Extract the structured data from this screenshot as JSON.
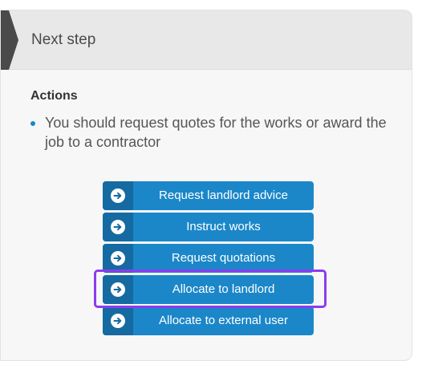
{
  "panel": {
    "title": "Next step"
  },
  "actions": {
    "heading": "Actions",
    "bullets": [
      "You should request quotes for the works or award the job to a contractor"
    ],
    "buttons": [
      {
        "label": "Request landlord advice",
        "icon": "arrow-right-circle-icon"
      },
      {
        "label": "Instruct works",
        "icon": "arrow-right-circle-icon"
      },
      {
        "label": "Request quotations",
        "icon": "arrow-right-circle-icon"
      },
      {
        "label": "Allocate to landlord",
        "icon": "arrow-right-circle-icon",
        "highlighted": true
      },
      {
        "label": "Allocate to external user",
        "icon": "arrow-right-circle-icon"
      }
    ]
  },
  "colors": {
    "button": "#1b87c9",
    "button_icon_bg": "#156aa1",
    "highlight": "#8b3cf0",
    "header_bg": "#e8e8e8",
    "header_marker": "#4a4a4a"
  }
}
